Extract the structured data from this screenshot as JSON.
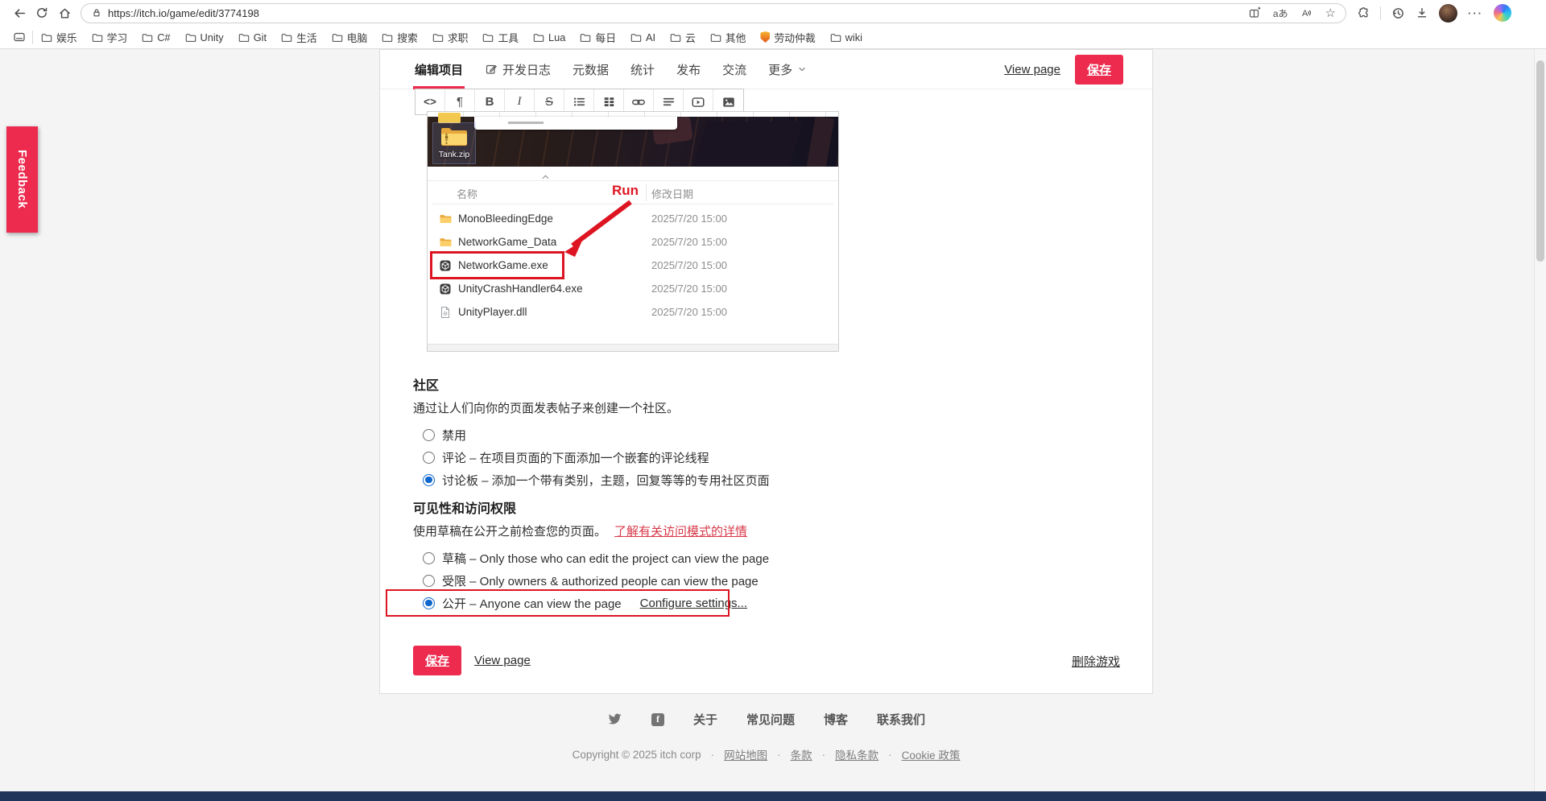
{
  "browser": {
    "url": "https://itch.io/game/edit/3774198",
    "bookmarks": [
      "娱乐",
      "学习",
      "C#",
      "Unity",
      "Git",
      "生活",
      "电脑",
      "搜索",
      "求职",
      "工具",
      "Lua",
      "每日",
      "AI",
      "云",
      "其他",
      "劳动仲裁",
      "wiki"
    ],
    "translate_glyph": "aあ"
  },
  "tabs": {
    "items": [
      "编辑项目",
      "开发日志",
      "元数据",
      "统计",
      "发布",
      "交流",
      "更多"
    ],
    "view_page": "View page",
    "save": "保存"
  },
  "editor": {
    "toolbar_glyphs": {
      "code": "<>",
      "paragraph": "¶",
      "bold": "B",
      "italic": "I",
      "strike": "S"
    },
    "image": {
      "desktop_label": "Tank.zip",
      "annotation_run": "Run",
      "columns": [
        "名称",
        "修改日期"
      ],
      "files": [
        {
          "name": "MonoBleedingEdge",
          "date": "2025/7/20 15:00",
          "type": "folder"
        },
        {
          "name": "NetworkGame_Data",
          "date": "2025/7/20 15:00",
          "type": "folder"
        },
        {
          "name": "NetworkGame.exe",
          "date": "2025/7/20 15:00",
          "type": "unity-exe",
          "highlighted": true
        },
        {
          "name": "UnityCrashHandler64.exe",
          "date": "2025/7/20 15:00",
          "type": "unity-exe"
        },
        {
          "name": "UnityPlayer.dll",
          "date": "2025/7/20 15:00",
          "type": "dll"
        }
      ]
    }
  },
  "community": {
    "title": "社区",
    "description": "通过让人们向你的页面发表帖子来创建一个社区。",
    "options": [
      {
        "label": "禁用",
        "selected": false
      },
      {
        "label": "评论 – 在项目页面的下面添加一个嵌套的评论线程",
        "selected": false
      },
      {
        "label": "讨论板 – 添加一个带有类别，主题，回复等等的专用社区页面",
        "selected": true
      }
    ]
  },
  "visibility": {
    "title": "可见性和访问权限",
    "description": "使用草稿在公开之前检查您的页面。",
    "learn_more": "了解有关访问模式的详情",
    "options": [
      {
        "label": "草稿 – Only those who can edit the project can view the page",
        "selected": false
      },
      {
        "label": "受限 – Only owners & authorized people can view the page",
        "selected": false
      },
      {
        "label": "公开 – Anyone can view the page",
        "selected": true,
        "extra_link": "Configure settings..."
      }
    ]
  },
  "actions": {
    "save": "保存",
    "view_page": "View page",
    "delete": "删除游戏"
  },
  "footer": {
    "nav": [
      "关于",
      "常见问题",
      "博客",
      "联系我们"
    ],
    "copyright": "Copyright © 2025 itch corp",
    "legal": [
      "网站地图",
      "条款",
      "隐私条款",
      "Cookie 政策"
    ],
    "separator": "·"
  },
  "feedback_label": "Feedback",
  "colors": {
    "accent": "#ec2b4f",
    "annotation": "#dd1522",
    "link_red": "#d83a4a",
    "radio_blue": "#0f66cc",
    "folder_yellow": "#f7c64f",
    "taskbar": "#20355a"
  }
}
